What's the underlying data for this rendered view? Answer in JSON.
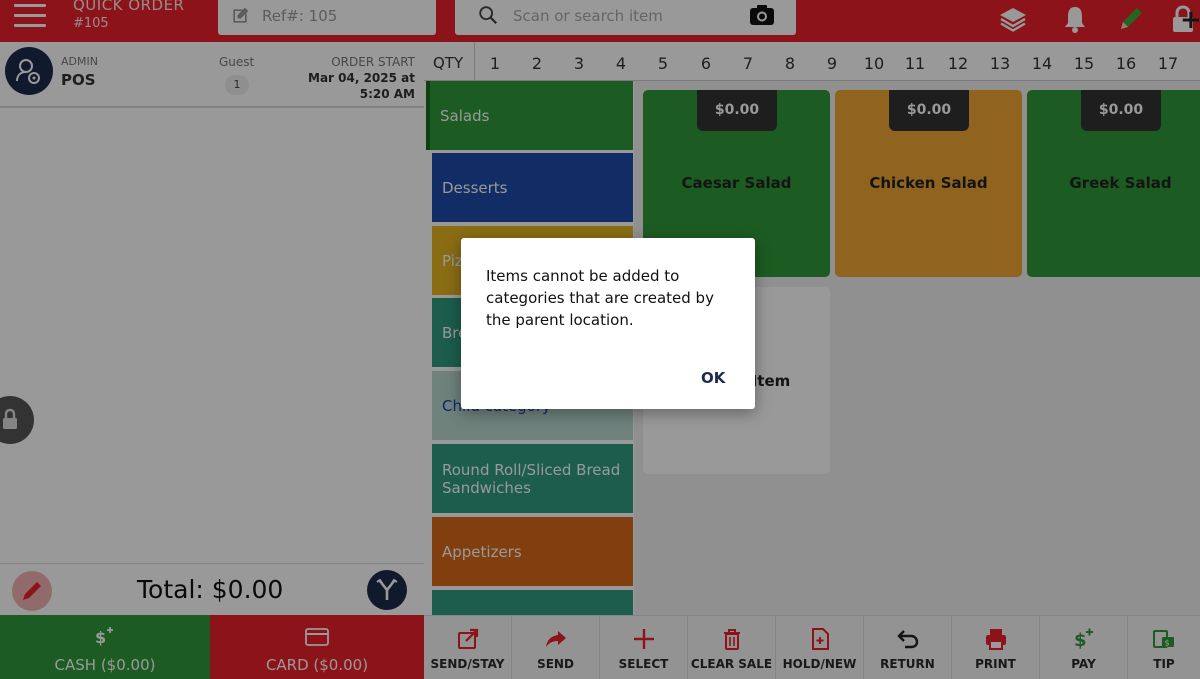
{
  "header": {
    "title": "QUICK ORDER",
    "order_number": "#105",
    "ref_text": "Ref#: 105",
    "search_placeholder": "Scan or search item"
  },
  "order_panel": {
    "role": "ADMIN",
    "user": "POS",
    "guest_label": "Guest",
    "guest_count": "1",
    "order_start_label": "ORDER START",
    "order_start_date": "Mar 04, 2025 at",
    "order_start_time": "5:20 AM",
    "total": "Total: $0.00",
    "cash_label": "CASH ($0.00)",
    "card_label": "CARD ($0.00)"
  },
  "qty_bar": {
    "label": "QTY",
    "numbers": [
      "1",
      "2",
      "3",
      "4",
      "5",
      "6",
      "7",
      "8",
      "9",
      "10",
      "11",
      "12",
      "13",
      "14",
      "15",
      "16",
      "17"
    ]
  },
  "categories": [
    {
      "label": "Salads",
      "color": "#2f9a3a",
      "selected": true
    },
    {
      "label": "Desserts",
      "color": "#1f4aa8",
      "selected": false
    },
    {
      "label": "Pizza",
      "color": "#e6b422",
      "selected": false
    },
    {
      "label": "Breakfast",
      "color": "#2f9c7e",
      "selected": false
    },
    {
      "label": "Child category",
      "color": "#b9d9cf",
      "text_color": "#1f3fb0",
      "selected": false
    },
    {
      "label": "Round Roll/Sliced Bread Sandwiches",
      "color": "#2f9c7e",
      "selected": false
    },
    {
      "label": "Appetizers",
      "color": "#d8691c",
      "selected": false
    },
    {
      "label": "",
      "color": "#2f9c7e",
      "selected": false
    }
  ],
  "items": [
    {
      "name": "Caesar Salad",
      "price": "$0.00",
      "color": "#2f9a3a"
    },
    {
      "name": "Chicken Salad",
      "price": "$0.00",
      "color": "#f0a534"
    },
    {
      "name": "Greek Salad",
      "price": "$0.00",
      "color": "#2f9a3a"
    },
    {
      "name": "Custom Item",
      "price": "",
      "color": "#ffffff"
    }
  ],
  "toolbar": [
    {
      "label": "SEND/STAY",
      "icon": "send-stay-icon"
    },
    {
      "label": "SEND",
      "icon": "send-icon"
    },
    {
      "label": "SELECT",
      "icon": "plus-icon"
    },
    {
      "label": "CLEAR SALE",
      "icon": "trash-icon"
    },
    {
      "label": "HOLD/NEW",
      "icon": "hold-new-icon"
    },
    {
      "label": "RETURN",
      "icon": "return-icon"
    },
    {
      "label": "PRINT",
      "icon": "printer-icon"
    },
    {
      "label": "PAY",
      "icon": "pay-icon"
    },
    {
      "label": "TIP",
      "icon": "tip-icon"
    }
  ],
  "dialog": {
    "message": "Items cannot be added to categories that are created by the parent location.",
    "ok_label": "OK"
  },
  "colors": {
    "brand_red": "#e8202a",
    "navy": "#1d2a4a",
    "green": "#2f9a3a"
  }
}
